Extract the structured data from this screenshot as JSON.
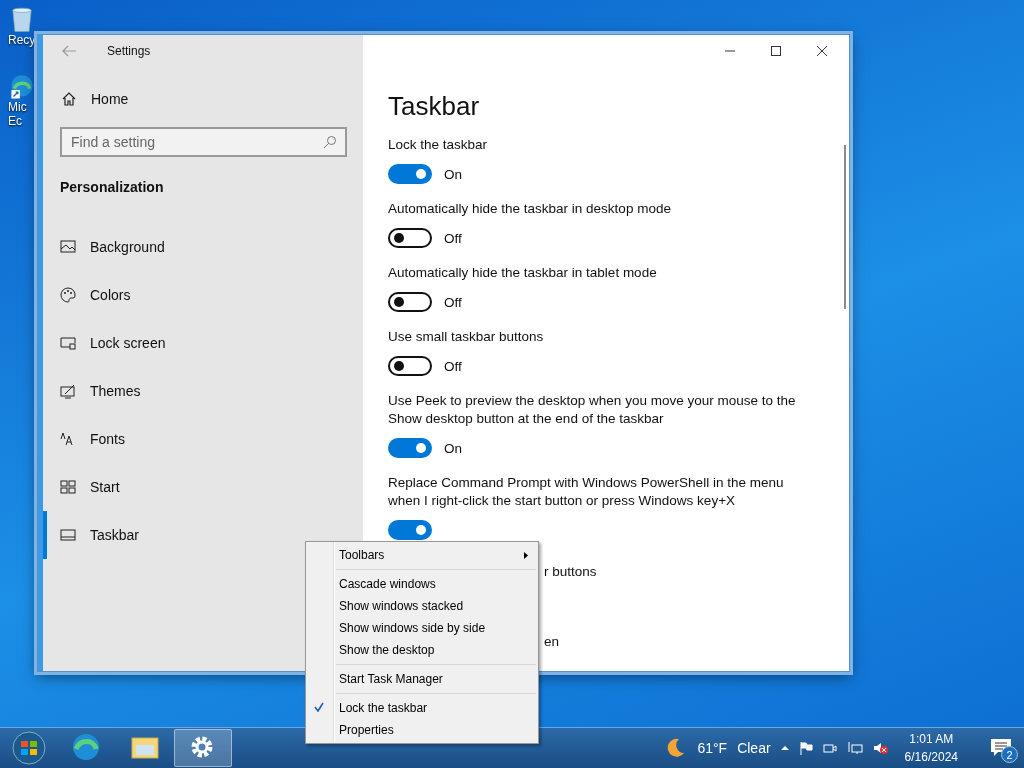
{
  "desktop_icons": [
    {
      "kind": "bin",
      "label": "Recy"
    },
    {
      "kind": "edge",
      "label": "Mic Ec"
    }
  ],
  "window": {
    "title": "Settings",
    "sidebar": {
      "home": "Home",
      "search": {
        "placeholder": "Find a setting"
      },
      "section": "Personalization",
      "items": [
        {
          "kind": "background",
          "label": "Background",
          "selected": false
        },
        {
          "kind": "colors",
          "label": "Colors",
          "selected": false
        },
        {
          "kind": "lock",
          "label": "Lock screen",
          "selected": false
        },
        {
          "kind": "themes",
          "label": "Themes",
          "selected": false
        },
        {
          "kind": "fonts",
          "label": "Fonts",
          "selected": false
        },
        {
          "kind": "start",
          "label": "Start",
          "selected": false
        },
        {
          "kind": "taskbar",
          "label": "Taskbar",
          "selected": true
        }
      ]
    },
    "content": {
      "title": "Taskbar",
      "settings": [
        {
          "kind": "toggle",
          "label": "Lock the taskbar",
          "on": true,
          "state_text": "On"
        },
        {
          "kind": "toggle",
          "label": "Automatically hide the taskbar in desktop mode",
          "on": false,
          "state_text": "Off"
        },
        {
          "kind": "toggle",
          "label": "Automatically hide the taskbar in tablet mode",
          "on": false,
          "state_text": "Off"
        },
        {
          "kind": "toggle",
          "label": "Use small taskbar buttons",
          "on": false,
          "state_text": "Off"
        },
        {
          "kind": "toggle",
          "label": "Use Peek to preview the desktop when you move your mouse to the Show desktop button at the end of the taskbar",
          "on": true,
          "state_text": "On"
        },
        {
          "kind": "toggle",
          "label": "Replace Command Prompt with Windows PowerShell in the menu when I right-click the start button or press Windows key+X",
          "on": true
        },
        {
          "kind": "partial",
          "label": "r buttons"
        },
        {
          "kind": "partial",
          "label": "en"
        }
      ]
    }
  },
  "context_menu": [
    {
      "kind": "item",
      "label": "Toolbars",
      "submenu": true,
      "checked": false
    },
    {
      "kind": "separator"
    },
    {
      "kind": "item",
      "label": "Cascade windows",
      "submenu": false,
      "checked": false
    },
    {
      "kind": "item",
      "label": "Show windows stacked",
      "submenu": false,
      "checked": false
    },
    {
      "kind": "item",
      "label": "Show windows side by side",
      "submenu": false,
      "checked": false
    },
    {
      "kind": "item",
      "label": "Show the desktop",
      "submenu": false,
      "checked": false
    },
    {
      "kind": "separator"
    },
    {
      "kind": "item",
      "label": "Start Task Manager",
      "submenu": false,
      "checked": false
    },
    {
      "kind": "separator"
    },
    {
      "kind": "item",
      "label": "Lock the taskbar",
      "submenu": false,
      "checked": true
    },
    {
      "kind": "item",
      "label": "Properties",
      "submenu": false,
      "checked": false
    }
  ],
  "taskbar": {
    "apps": [
      {
        "kind": "edge",
        "selected": false
      },
      {
        "kind": "explorer",
        "selected": false
      },
      {
        "kind": "settings",
        "selected": true
      }
    ],
    "weather": {
      "temperature": "61°F",
      "condition": "Clear"
    },
    "time": "1:01 AM",
    "date": "6/16/2024",
    "notification_count": "2"
  }
}
